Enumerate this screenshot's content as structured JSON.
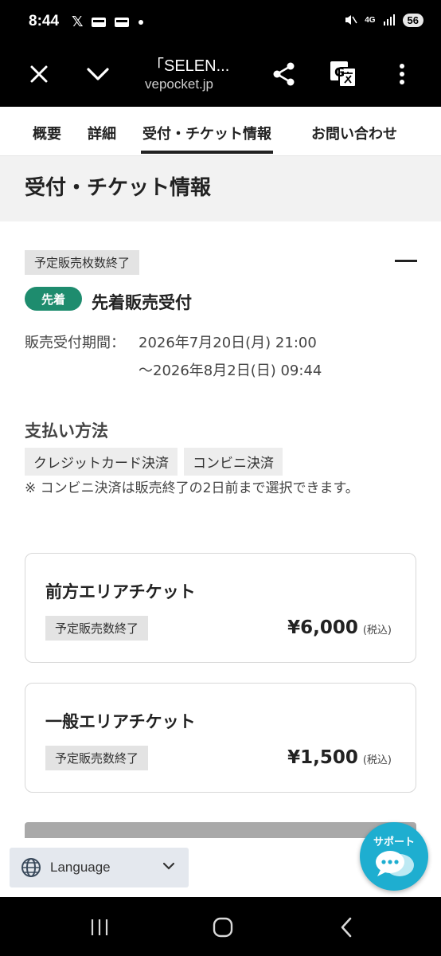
{
  "status_bar": {
    "time": "8:44",
    "network": "4G",
    "battery": "56",
    "icons": [
      "x-icon",
      "mail-icon",
      "mail-icon",
      "dot-icon",
      "mute-icon",
      "signal-icon"
    ]
  },
  "toolbar": {
    "title": "「SELEN...",
    "url": "vepocket.jp",
    "icons": [
      "close-icon",
      "chevron-down-icon",
      "share-icon",
      "translate-icon",
      "more-icon"
    ]
  },
  "tabs": [
    {
      "label": "概要"
    },
    {
      "label": "詳細"
    },
    {
      "label": "受付・チケット情報",
      "active": true
    },
    {
      "label": "お問い合わせ"
    }
  ],
  "section": {
    "title": "受付・チケット情報"
  },
  "sale": {
    "status_badge": "予定販売枚数終了",
    "type_badge": "先着",
    "title": "先着販売受付",
    "period_label": "販売受付期間：",
    "period_start": "2026年7月20日(月) 21:00",
    "period_end": "〜2026年8月2日(日) 09:44",
    "type_badge_color": "#1e8c6e"
  },
  "payment": {
    "title": "支払い方法",
    "methods": [
      "クレジットカード決済",
      "コンビニ決済"
    ],
    "note": "※ コンビニ決済は販売終了の2日前まで選択できます。"
  },
  "tickets": [
    {
      "name": "前方エリアチケット",
      "status": "予定販売数終了",
      "price": "¥6,000",
      "tax": "(税込)"
    },
    {
      "name": "一般エリアチケット",
      "status": "予定販売数終了",
      "price": "¥1,500",
      "tax": "(税込)"
    }
  ],
  "language": {
    "label": "Language"
  },
  "support": {
    "label": "サポート",
    "color": "#1eaed0"
  }
}
